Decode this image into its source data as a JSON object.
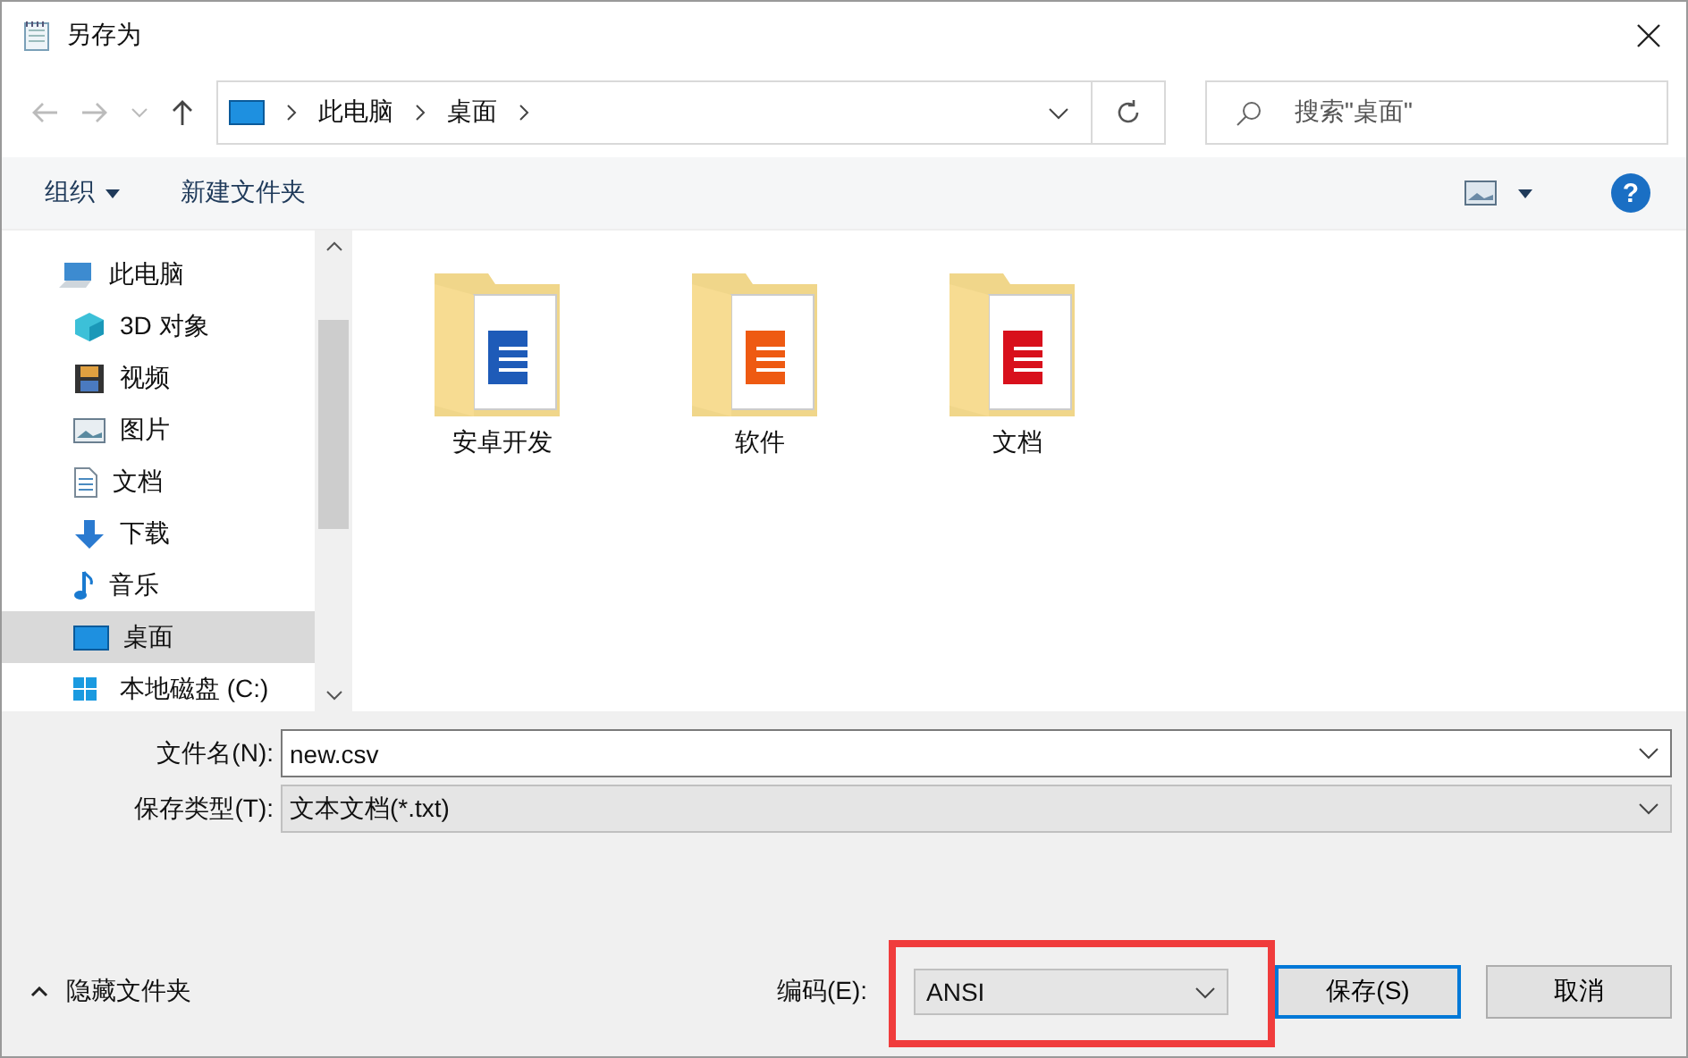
{
  "window": {
    "title": "另存为"
  },
  "address_bar": {
    "crumbs": [
      "此电脑",
      "桌面"
    ],
    "search_placeholder": "搜索\"桌面\""
  },
  "toolbar": {
    "organize": "组织",
    "new_folder": "新建文件夹",
    "help": "?"
  },
  "sidebar": {
    "items": [
      {
        "label": "此电脑",
        "selected": false
      },
      {
        "label": "3D 对象",
        "selected": false
      },
      {
        "label": "视频",
        "selected": false
      },
      {
        "label": "图片",
        "selected": false
      },
      {
        "label": "文档",
        "selected": false
      },
      {
        "label": "下载",
        "selected": false
      },
      {
        "label": "音乐",
        "selected": false
      },
      {
        "label": "桌面",
        "selected": true
      },
      {
        "label": "本地磁盘 (C:)",
        "selected": false
      }
    ]
  },
  "files": [
    {
      "name": "安卓开发"
    },
    {
      "name": "软件"
    },
    {
      "name": "文档"
    }
  ],
  "form": {
    "filename_label": "文件名(N):",
    "filename": "new.csv",
    "type_label": "保存类型(T):",
    "type": "文本文档(*.txt)"
  },
  "footer": {
    "hide_folders": "隐藏文件夹",
    "encoding_label": "编码(E):",
    "encoding": "ANSI",
    "encoding_highlighted": true,
    "save": "保存(S)",
    "cancel": "取消"
  }
}
